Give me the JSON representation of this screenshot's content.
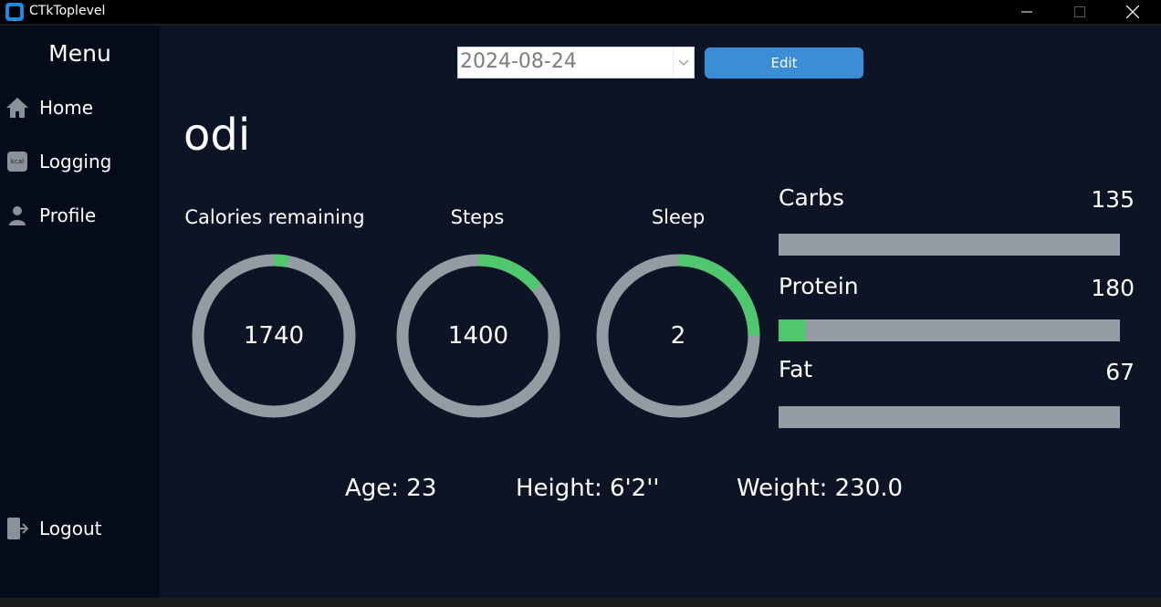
{
  "window": {
    "title": "CTkToplevel"
  },
  "sidebar": {
    "title": "Menu",
    "items": [
      {
        "label": "Home",
        "icon": "home-icon"
      },
      {
        "label": "Logging",
        "icon": "kcal-icon",
        "icon_text": "kcal"
      },
      {
        "label": "Profile",
        "icon": "person-icon"
      }
    ],
    "logout": {
      "label": "Logout",
      "icon": "logout-icon"
    }
  },
  "toolbar": {
    "date": "2024-08-24",
    "edit_label": "Edit"
  },
  "user": {
    "name": "odi"
  },
  "rings": [
    {
      "title": "Calories remaining",
      "value": "1740",
      "progress": 0.03
    },
    {
      "title": "Steps",
      "value": "1400",
      "progress": 0.14
    },
    {
      "title": "Sleep",
      "value": "2",
      "progress": 0.25
    }
  ],
  "macros": [
    {
      "label": "Carbs",
      "value": "135",
      "progress": 0
    },
    {
      "label": "Protein",
      "value": "180",
      "progress": 0.08
    },
    {
      "label": "Fat",
      "value": "67",
      "progress": 0
    }
  ],
  "profile": {
    "age": "Age: 23",
    "height": "Height: 6'2''",
    "weight": "Weight: 230.0"
  },
  "colors": {
    "background": "#0c1426",
    "sidebar": "#040b19",
    "accent": "#3b8ed5",
    "progress": "#4fc76c",
    "track": "#959ba2"
  }
}
